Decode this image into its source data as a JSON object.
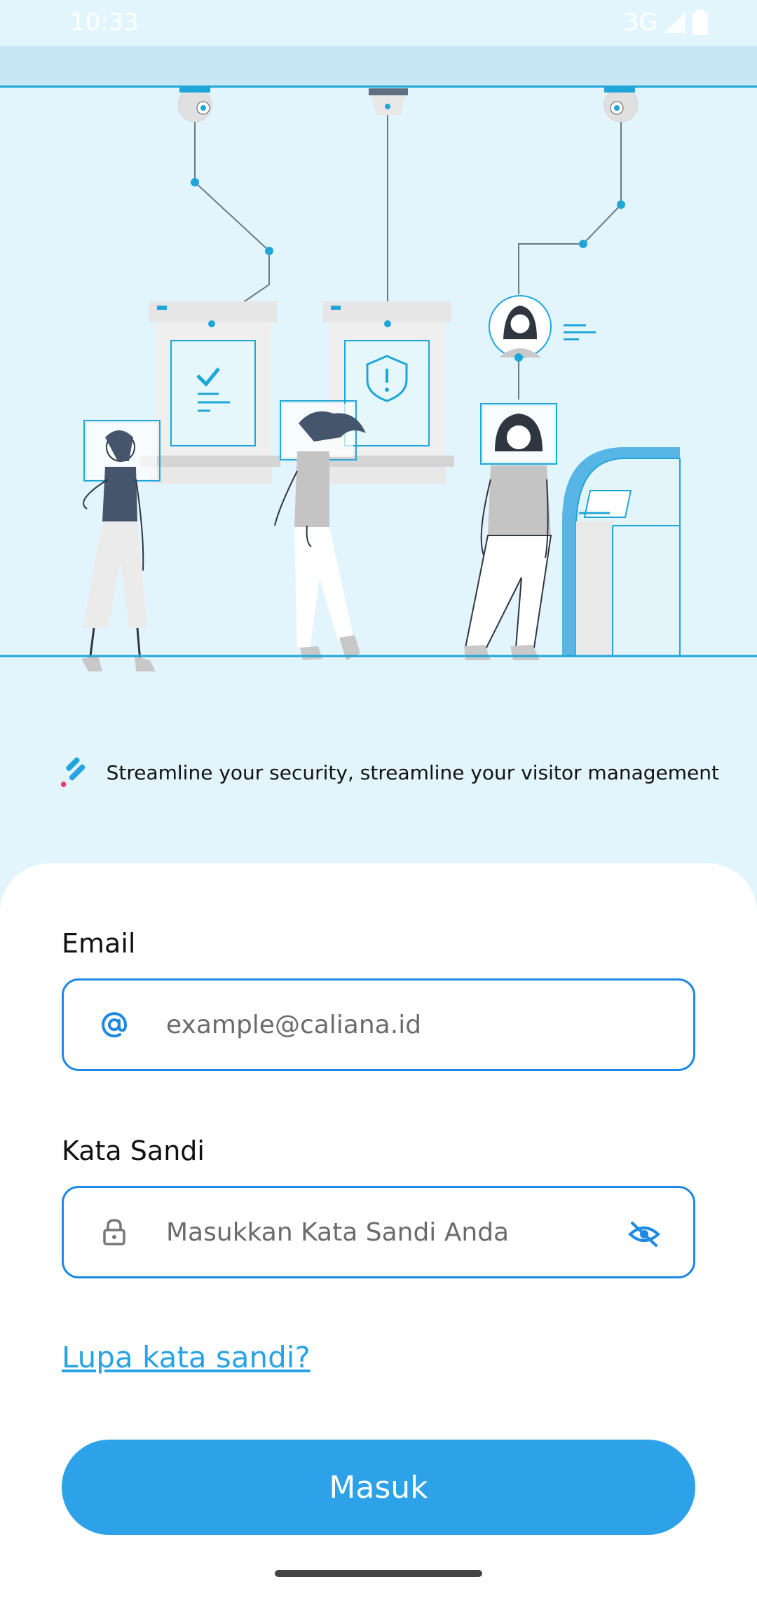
{
  "status_bar": {
    "time": "10:33",
    "network": "3G"
  },
  "tagline": "Streamline your security, streamline your visitor management",
  "form": {
    "email_label": "Email",
    "email_placeholder": "example@caliana.id",
    "email_icon": "at-icon",
    "password_label": "Kata Sandi",
    "password_placeholder": "Masukkan Kata Sandi Anda",
    "password_icon": "lock-icon",
    "visibility_icon": "eye-off-icon",
    "forgot_link": "Lupa kata sandi?",
    "submit_label": "Masuk"
  },
  "colors": {
    "background": "#e3f5fc",
    "accent": "#2ea2e8",
    "input_border": "#1e88e5",
    "link": "#29a3e3",
    "illustration_line": "#1fa6d8"
  }
}
